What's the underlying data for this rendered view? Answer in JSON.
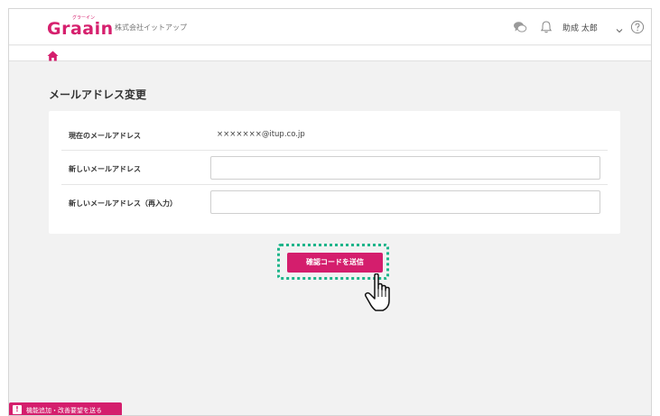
{
  "header": {
    "logo_text": "Graain",
    "logo_ruby": "グラーイン",
    "company": "株式会社イットアップ",
    "user_name": "助成 太郎"
  },
  "page": {
    "title": "メールアドレス変更"
  },
  "form": {
    "current_email_label": "現在のメールアドレス",
    "current_email_value": "×××××××@itup.co.jp",
    "new_email_label": "新しいメールアドレス",
    "new_email_value": "",
    "confirm_email_label": "新しいメールアドレス（再入力）",
    "confirm_email_value": ""
  },
  "actions": {
    "submit_label": "確認コードを送信"
  },
  "feedback": {
    "label": "機能追加・改善要望を送る",
    "icon_glyph": "!"
  },
  "colors": {
    "brand": "#d41e6d",
    "focus": "#1db58a"
  },
  "icons": [
    "chat-icon",
    "bell-icon",
    "chevron-down-icon",
    "help-icon",
    "home-icon",
    "hand-cursor-icon"
  ]
}
